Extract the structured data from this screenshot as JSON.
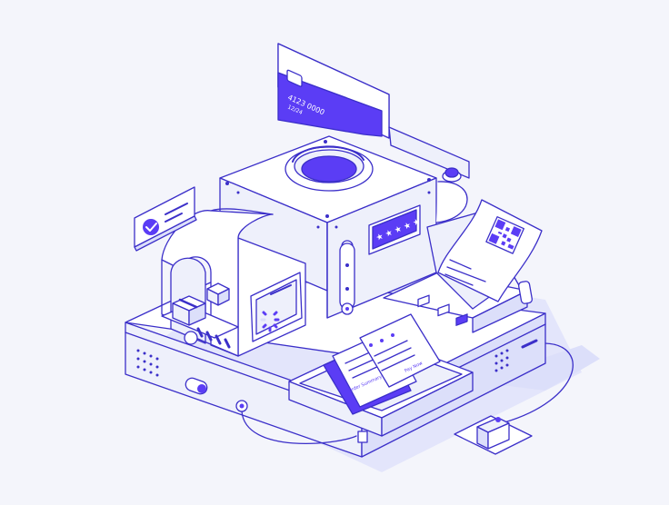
{
  "card": {
    "number": "4123 0000",
    "expiry": "12/24"
  },
  "invoice_labels": [
    "Order Summary",
    "Pay Now"
  ],
  "colors": {
    "background": "#f4f5fb",
    "outline": "#3b2fc9",
    "accent": "#5b3df5",
    "face_light": "#ffffff",
    "face_mid": "#eef0fb",
    "face_shade": "#dcdffa",
    "shadow": "#e3e5fb"
  },
  "icons": {
    "check_badge": "checkmark-icon",
    "package": "box-icon",
    "qr": "qr-code-icon",
    "loader": "spinner-icon"
  }
}
